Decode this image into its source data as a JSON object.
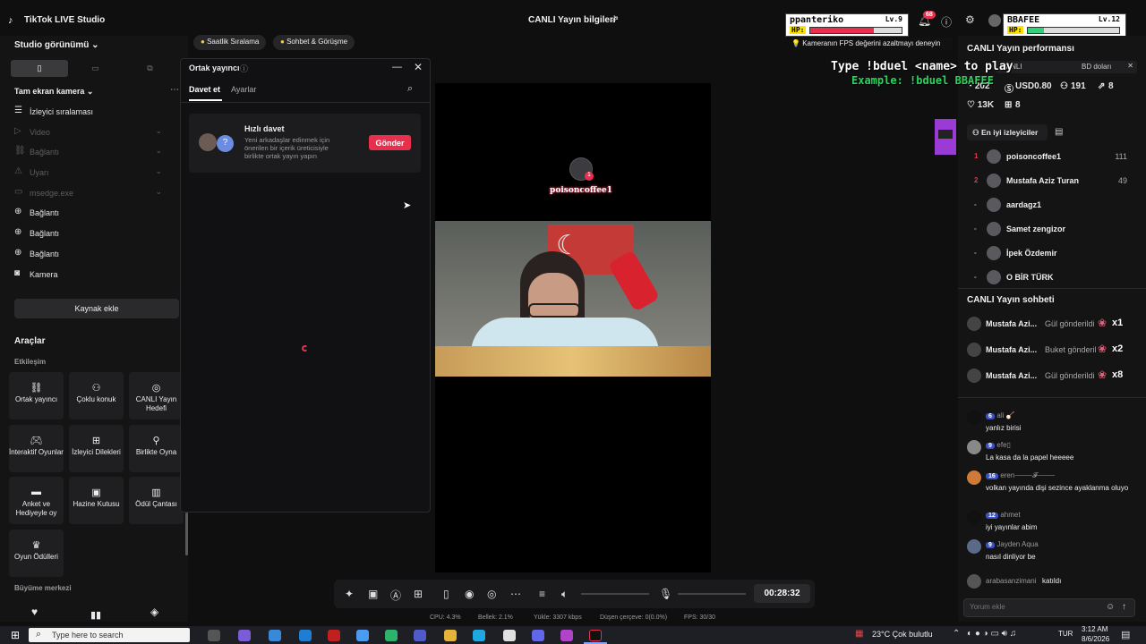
{
  "app": {
    "title": "TikTok LIVE Studio",
    "center_title": "CANLI Yayın bilgileri"
  },
  "hud": [
    {
      "name": "ppanteriko",
      "level": "Lv.9",
      "hp": "HP:",
      "hp_pct": 0.7,
      "color": "#e8304e"
    },
    {
      "name": "BBAFEE",
      "level": "Lv.12",
      "hp": "HP:",
      "hp_pct": 0.18,
      "color": "#31d07c"
    }
  ],
  "notif_count": "68",
  "fps_tip": "Kameranın FPS değerini azaltmayı deneyin",
  "game_overlay": {
    "line1": "Type !bduel <name> to play",
    "line2": "Example: !bduel BBAFEE",
    "pixel_char_color": "#9b3bd6"
  },
  "left": {
    "studio_view": "Studio görünümü",
    "scene": "Tam ekran kamera",
    "sources": [
      {
        "label": "İzleyici sıralaması",
        "icon": "list-icon",
        "dim": false,
        "chev": false
      },
      {
        "label": "Video",
        "icon": "play-icon",
        "dim": true,
        "chev": true
      },
      {
        "label": "Bağlantı",
        "icon": "link-icon",
        "dim": true,
        "chev": true
      },
      {
        "label": "Uyarı",
        "icon": "alert-icon",
        "dim": true,
        "chev": true
      },
      {
        "label": "msedge.exe",
        "icon": "window-icon",
        "dim": true,
        "chev": true
      },
      {
        "label": "Bağlantı",
        "icon": "globe-icon",
        "dim": false,
        "chev": false
      },
      {
        "label": "Bağlantı",
        "icon": "globe-icon",
        "dim": false,
        "chev": false
      },
      {
        "label": "Bağlantı",
        "icon": "globe-icon",
        "dim": false,
        "chev": false
      },
      {
        "label": "Kamera",
        "icon": "camera-icon",
        "dim": false,
        "chev": false
      }
    ],
    "add_source": "Kaynak ekle",
    "tools_title": "Araçlar",
    "interaction_title": "Etkileşim",
    "tools": [
      {
        "label": "Ortak yayıncı",
        "icon": "link-icon"
      },
      {
        "label": "Çoklu konuk",
        "icon": "users-icon"
      },
      {
        "label": "CANLI Yayın Hedefi",
        "icon": "target-icon"
      },
      {
        "label": "İnteraktif Oyunlar",
        "icon": "gamepad-icon"
      },
      {
        "label": "İzleyici Dilekleri",
        "icon": "gift-icon"
      },
      {
        "label": "Birlikte Oyna",
        "icon": "joystick-icon"
      },
      {
        "label": "Anket ve Hediyeyle oy",
        "icon": "poll-icon"
      },
      {
        "label": "Hazine Kutusu",
        "icon": "chest-icon"
      },
      {
        "label": "Ödül Çantası",
        "icon": "bag-icon"
      },
      {
        "label": "Oyun Ödülleri",
        "icon": "trophy-icon"
      }
    ],
    "growth_title": "Büyüme merkezi"
  },
  "chips": [
    "Saatlik Sıralama",
    "Sohbet & Görüşme"
  ],
  "popup": {
    "title": "Ortak yayıncı",
    "tabs": [
      "Davet et",
      "Ayarlar"
    ],
    "card_title": "Hızlı davet",
    "card_desc": "Yeni arkadaşlar edinmek için önerilen bir içerik üreticisiyle birlikte ortak yayın yapın",
    "send": "Gönder"
  },
  "preview": {
    "guest_name": "poisoncoffee1"
  },
  "toolbar": {
    "timer": "00:28:32"
  },
  "stats": {
    "cpu": "CPU: 4.3%",
    "mem": "Bellek: 2.1%",
    "upload": "Yükle: 3307 kbps",
    "dropped": "Düşen çerçeve: 0(0.0%)",
    "fps": "FPS: 30/30"
  },
  "right": {
    "perf_title": "CANLI Yayın performansı",
    "banner_left": "CANLI",
    "banner_right": "BD doları",
    "m_views": "202",
    "m_money": "USD0.80",
    "m_users": "191",
    "m_share": "8",
    "m_likes": "13K",
    "m_gifts": "8",
    "top_viewers_btn": "En iyi izleyiciler",
    "viewers": [
      {
        "rank": "1",
        "name": "poisoncoffee1",
        "score": "111"
      },
      {
        "rank": "2",
        "name": "Mustafa Aziz Turan",
        "score": "49"
      },
      {
        "rank": "-",
        "name": "aardagz1",
        "score": ""
      },
      {
        "rank": "-",
        "name": "Samet zengizor",
        "score": ""
      },
      {
        "rank": "-",
        "name": "İpek Özdemir",
        "score": ""
      },
      {
        "rank": "-",
        "name": "O BİR TÜRK",
        "score": ""
      }
    ],
    "chat_title": "CANLI Yayın sohbeti",
    "gifts": [
      {
        "name": "Mustafa Azi...",
        "text": "Gül gönderildi",
        "count": "x1"
      },
      {
        "name": "Mustafa Azi...",
        "text": "Buket gönderil",
        "count": "x2"
      },
      {
        "name": "Mustafa Azi...",
        "text": "Gül gönderildi",
        "count": "x8"
      }
    ],
    "comments": [
      {
        "level": "6",
        "user": "ali 🪕",
        "msg": "yanlız birisi"
      },
      {
        "level": "9",
        "user": "efe▯",
        "msg": "La kasa da la papel heeeee"
      },
      {
        "level": "16",
        "user": "eren⸻𝓕⸻",
        "msg": "volkan yayında dişi sezince ayaklanma oluyo"
      },
      {
        "level": "12",
        "user": "ahmet",
        "msg": "iyi yayınlar abim"
      },
      {
        "level": "9",
        "user": "Jayden Aqua",
        "msg": "nasıl dinliyor be"
      }
    ],
    "joined_user": "arabasanzimani",
    "joined_text": "katıldı",
    "comment_placeholder": "Yorum ekle"
  },
  "taskbar": {
    "search": "Type here to search",
    "weather": "23°C  Çok bulutlu",
    "lang": "TUR",
    "time": "3:12 AM",
    "date": "8/6/2026"
  }
}
